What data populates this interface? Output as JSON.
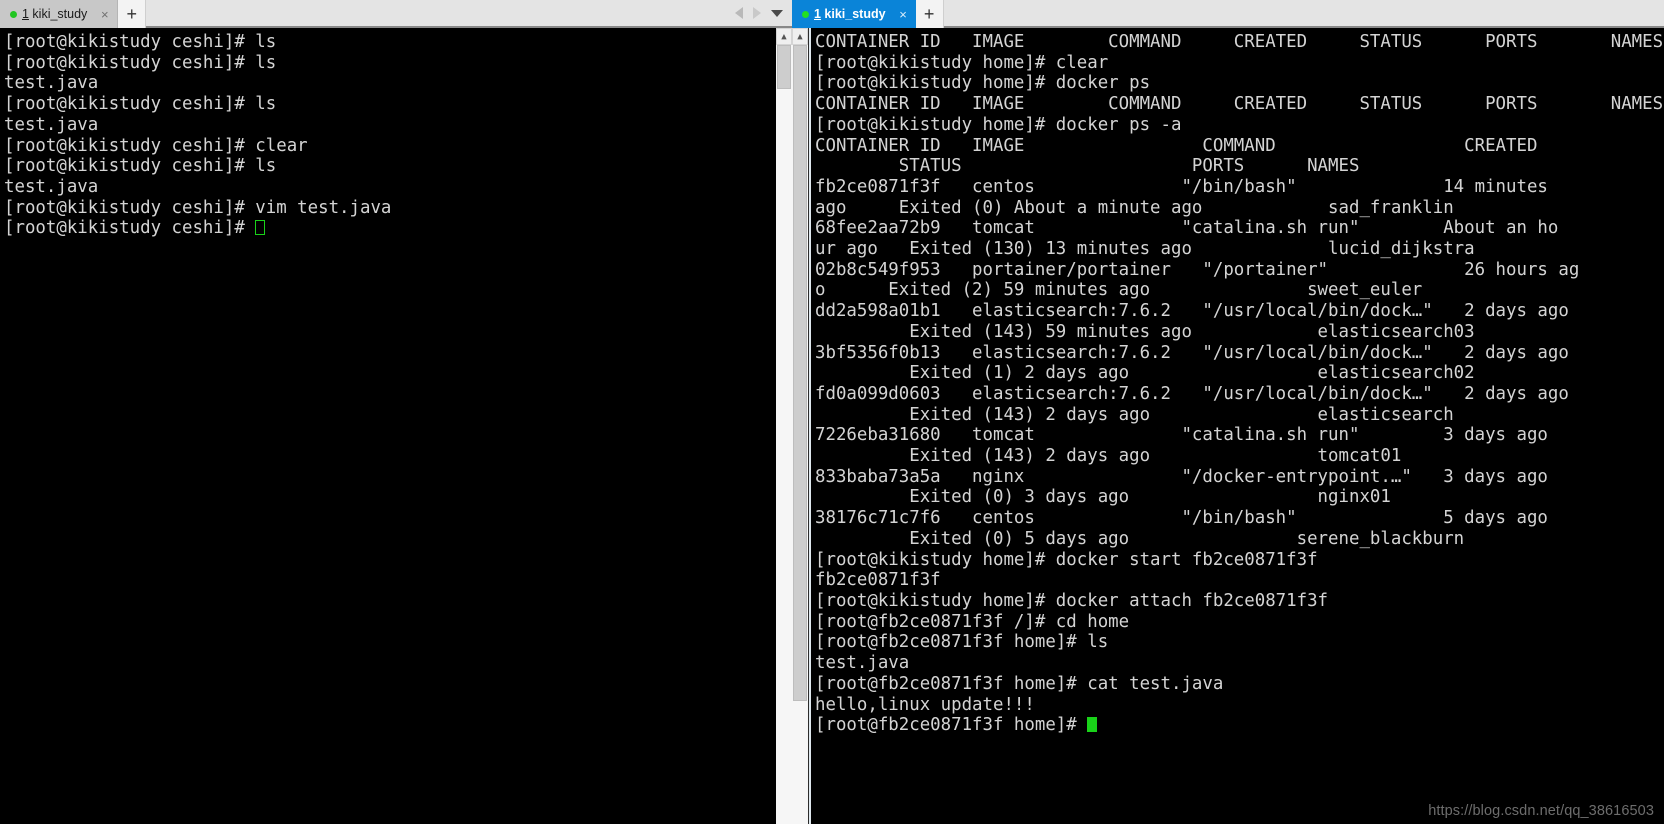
{
  "left_window": {
    "tab": {
      "dot": "status-dot",
      "number": "1",
      "title": " kiki_study",
      "close": "×"
    },
    "new_tab_label": "+",
    "nav": {
      "prev": "prev-arrow",
      "next": "next-arrow",
      "menu": "caret-down"
    },
    "terminal_lines": [
      "[root@kikistudy ceshi]# ls",
      "[root@kikistudy ceshi]# ls",
      "test.java",
      "[root@kikistudy ceshi]# ls",
      "test.java",
      "[root@kikistudy ceshi]# clear",
      "[root@kikistudy ceshi]# ls",
      "test.java",
      "[root@kikistudy ceshi]# vim test.java"
    ],
    "prompt_line": "[root@kikistudy ceshi]# ",
    "cursor": "hollow-green-block"
  },
  "right_window": {
    "tab": {
      "dot": "status-dot",
      "number": "1",
      "title": " kiki_study",
      "close": "×"
    },
    "new_tab_label": "+",
    "terminal_lines": [
      "CONTAINER ID   IMAGE        COMMAND     CREATED     STATUS      PORTS       NAMES",
      "[root@kikistudy home]# clear",
      "[root@kikistudy home]# docker ps",
      "CONTAINER ID   IMAGE        COMMAND     CREATED     STATUS      PORTS       NAMES",
      "[root@kikistudy home]# docker ps -a",
      "CONTAINER ID   IMAGE                 COMMAND                  CREATED",
      "        STATUS                      PORTS      NAMES",
      "fb2ce0871f3f   centos              \"/bin/bash\"              14 minutes",
      "ago     Exited (0) About a minute ago            sad_franklin",
      "68fee2aa72b9   tomcat              \"catalina.sh run\"        About an ho",
      "ur ago   Exited (130) 13 minutes ago             lucid_dijkstra",
      "02b8c549f953   portainer/portainer   \"/portainer\"             26 hours ag",
      "o      Exited (2) 59 minutes ago               sweet_euler",
      "dd2a598a01b1   elasticsearch:7.6.2   \"/usr/local/bin/dock…\"   2 days ago",
      "         Exited (143) 59 minutes ago            elasticsearch03",
      "3bf5356f0b13   elasticsearch:7.6.2   \"/usr/local/bin/dock…\"   2 days ago",
      "         Exited (1) 2 days ago                  elasticsearch02",
      "fd0a099d0603   elasticsearch:7.6.2   \"/usr/local/bin/dock…\"   2 days ago",
      "         Exited (143) 2 days ago                elasticsearch",
      "7226eba31680   tomcat              \"catalina.sh run\"        3 days ago",
      "         Exited (143) 2 days ago                tomcat01",
      "833baba73a5a   nginx               \"/docker-entrypoint.…\"   3 days ago",
      "         Exited (0) 3 days ago                  nginx01",
      "38176c71c7f6   centos              \"/bin/bash\"              5 days ago",
      "         Exited (0) 5 days ago                serene_blackburn",
      "[root@kikistudy home]# docker start fb2ce0871f3f",
      "fb2ce0871f3f",
      "[root@kikistudy home]# docker attach fb2ce0871f3f",
      "[root@fb2ce0871f3f /]# cd home",
      "[root@fb2ce0871f3f home]# ls",
      "test.java",
      "[root@fb2ce0871f3f home]# cat test.java",
      "hello,linux update!!!"
    ],
    "prompt_line": "[root@fb2ce0871f3f home]# ",
    "cursor": "filled-green-block"
  },
  "watermark": "https://blog.csdn.net/qq_38616503",
  "colors": {
    "terminal_bg": "#000000",
    "terminal_fg": "#d4d4d4",
    "active_tab": "#0a84d8",
    "inactive_tab": "#c8c8c8",
    "tabbar_bg": "#e4e4e4",
    "cursor_green": "#19d219"
  }
}
